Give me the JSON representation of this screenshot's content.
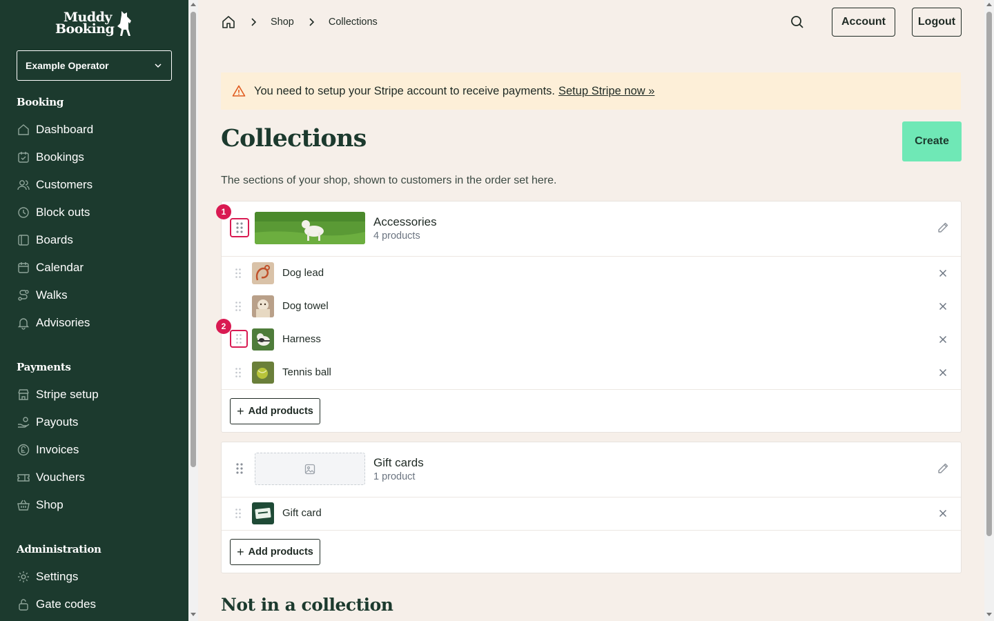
{
  "brand": {
    "line1": "Muddy",
    "line2": "Booking"
  },
  "operator": {
    "selected": "Example Operator"
  },
  "sidebar": {
    "sections": [
      {
        "title": "Booking",
        "items": [
          {
            "label": "Dashboard",
            "icon": "home-icon"
          },
          {
            "label": "Bookings",
            "icon": "calendar-check-icon"
          },
          {
            "label": "Customers",
            "icon": "users-icon"
          },
          {
            "label": "Block outs",
            "icon": "clock-icon"
          },
          {
            "label": "Boards",
            "icon": "board-icon"
          },
          {
            "label": "Calendar",
            "icon": "calendar-icon"
          },
          {
            "label": "Walks",
            "icon": "route-icon"
          },
          {
            "label": "Advisories",
            "icon": "bell-icon"
          }
        ]
      },
      {
        "title": "Payments",
        "items": [
          {
            "label": "Stripe setup",
            "icon": "store-icon"
          },
          {
            "label": "Payouts",
            "icon": "hand-coins-icon"
          },
          {
            "label": "Invoices",
            "icon": "pound-icon"
          },
          {
            "label": "Vouchers",
            "icon": "ticket-icon"
          },
          {
            "label": "Shop",
            "icon": "basket-icon"
          }
        ]
      },
      {
        "title": "Administration",
        "items": [
          {
            "label": "Settings",
            "icon": "gear-icon"
          },
          {
            "label": "Gate codes",
            "icon": "lock-icon"
          }
        ]
      }
    ]
  },
  "breadcrumb": {
    "items": [
      "Shop",
      "Collections"
    ]
  },
  "header": {
    "account_label": "Account",
    "logout_label": "Logout"
  },
  "alert": {
    "message": "You need to setup your Stripe account to receive payments.",
    "link": "Setup Stripe now »"
  },
  "page": {
    "title": "Collections",
    "create_label": "Create",
    "subtitle": "The sections of your shop, shown to customers in the order set here.",
    "not_in_collection_heading": "Not in a collection"
  },
  "collections": [
    {
      "name": "Accessories",
      "count": "4 products",
      "products": [
        "Dog lead",
        "Dog towel",
        "Harness",
        "Tennis ball"
      ],
      "add_label": "Add products"
    },
    {
      "name": "Gift cards",
      "count": "1 product",
      "products": [
        "Gift card"
      ],
      "add_label": "Add products"
    }
  ],
  "markers": [
    "1",
    "2"
  ],
  "colors": {
    "sidebar": "#1c3a2e",
    "accent": "#6fe8b6",
    "alert_bg": "#fdefd8",
    "marker": "#d91a52",
    "background": "#f6efe9"
  }
}
